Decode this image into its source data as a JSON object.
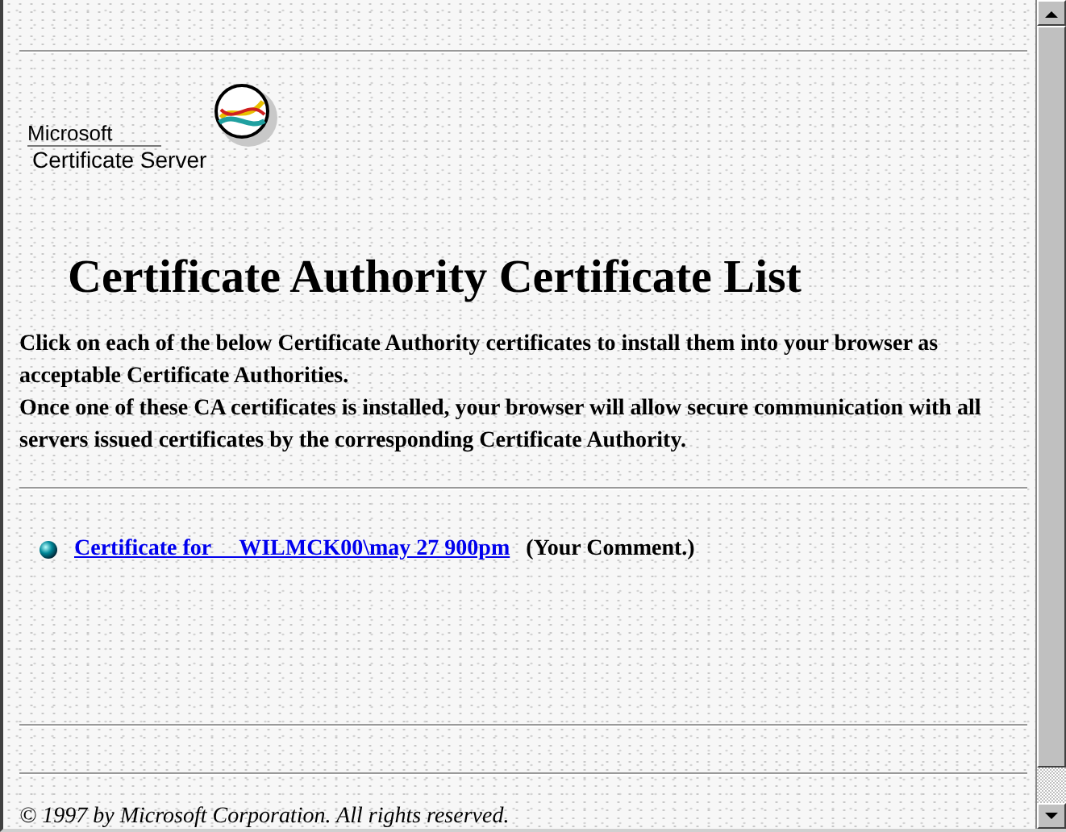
{
  "logo": {
    "brand": "Microsoft",
    "product": "Certificate Server"
  },
  "heading": "Certificate Authority Certificate List",
  "paragraphs": [
    "Click on each of the below Certificate Authority certificates to install them into your browser as acceptable Certificate Authorities.",
    "Once one of these CA certificates is installed, your browser will allow secure communication with all servers issued certificates by the corresponding Certificate Authority."
  ],
  "certificates": [
    {
      "link": "Certificate for     WILMCK00\\may 27 900pm",
      "comment": "(Your Comment.)"
    }
  ],
  "footer": "© 1997 by Microsoft Corporation. All rights reserved."
}
